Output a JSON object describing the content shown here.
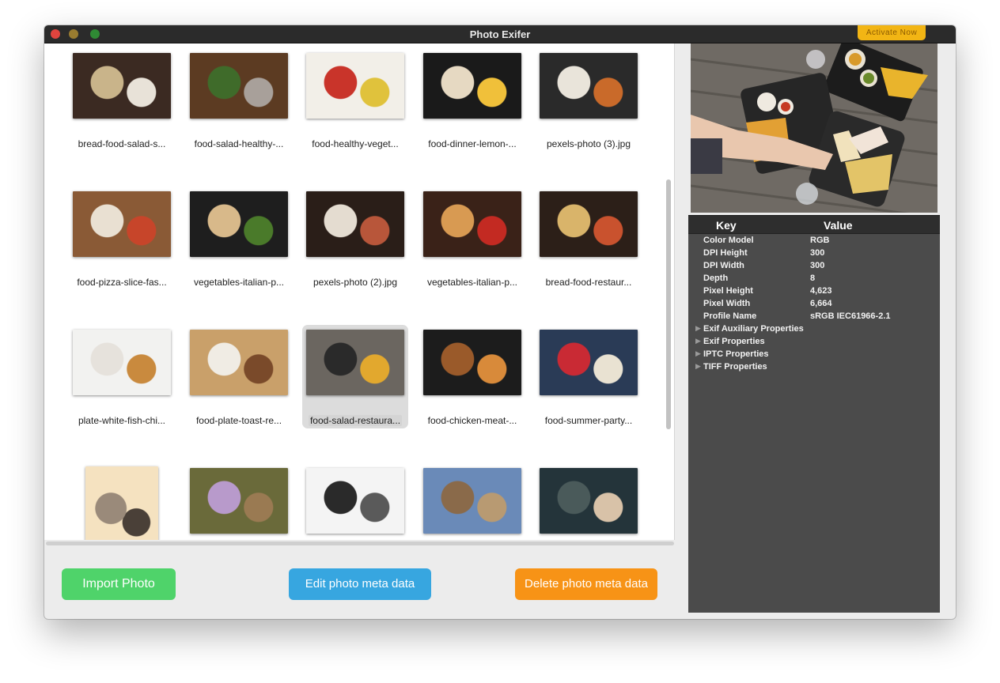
{
  "window": {
    "title": "Photo Exifer",
    "activate_label": "Activate Now"
  },
  "photos": [
    {
      "caption": "bread-food-salad-s...",
      "colors": [
        "#3b2a22",
        "#c9b48a",
        "#e8e2d8"
      ]
    },
    {
      "caption": "food-salad-healthy-...",
      "colors": [
        "#5c3b22",
        "#3f6b2a",
        "#a8a09a"
      ]
    },
    {
      "caption": "food-healthy-veget...",
      "colors": [
        "#f2efe8",
        "#c9342a",
        "#e0c23c"
      ]
    },
    {
      "caption": "food-dinner-lemon-...",
      "colors": [
        "#1a1a1a",
        "#e6d9c2",
        "#f0c03a"
      ]
    },
    {
      "caption": "pexels-photo (3).jpg",
      "colors": [
        "#2a2a2a",
        "#e9e4da",
        "#c96a2a"
      ]
    },
    {
      "caption": "food-pizza-slice-fas...",
      "colors": [
        "#8a5a36",
        "#e9e0d2",
        "#c7452a"
      ]
    },
    {
      "caption": "vegetables-italian-p...",
      "colors": [
        "#1e1e1e",
        "#d8b98a",
        "#4a7a2a"
      ]
    },
    {
      "caption": "pexels-photo (2).jpg",
      "colors": [
        "#2a1e18",
        "#e4dcd0",
        "#b8563a"
      ]
    },
    {
      "caption": "vegetables-italian-p...",
      "colors": [
        "#3a2218",
        "#d89a52",
        "#c32a22"
      ]
    },
    {
      "caption": "bread-food-restaur...",
      "colors": [
        "#2c1f18",
        "#d9b46a",
        "#c9522e"
      ]
    },
    {
      "caption": "plate-white-fish-chi...",
      "colors": [
        "#f2f2f0",
        "#e6e2dc",
        "#c98a3e"
      ]
    },
    {
      "caption": "food-plate-toast-re...",
      "colors": [
        "#c9a06a",
        "#f0ece4",
        "#7a4a2a"
      ]
    },
    {
      "caption": "food-salad-restaura...",
      "colors": [
        "#6b6660",
        "#2a2a2a",
        "#e2a82e"
      ]
    },
    {
      "caption": "food-chicken-meat-...",
      "colors": [
        "#1c1c1c",
        "#9a5a2a",
        "#d88a3a"
      ]
    },
    {
      "caption": "food-summer-party...",
      "colors": [
        "#2a3b56",
        "#c92a34",
        "#e9e2d2"
      ]
    },
    {
      "caption": "",
      "colors": [
        "#f5e2c0",
        "#9a8a7a",
        "#4a4038"
      ]
    },
    {
      "caption": "",
      "colors": [
        "#6a6a3a",
        "#b89acb",
        "#9a7a52"
      ]
    },
    {
      "caption": "",
      "colors": [
        "#f4f4f4",
        "#2a2a2a",
        "#5a5a5a"
      ]
    },
    {
      "caption": "",
      "colors": [
        "#6a8ab8",
        "#8a6a4a",
        "#b89a72"
      ]
    },
    {
      "caption": "",
      "colors": [
        "#24343a",
        "#4a5a5a",
        "#d8c2a8"
      ]
    }
  ],
  "selected_index": 12,
  "buttons": {
    "import": "Import Photo",
    "edit": "Edit photo meta data",
    "delete": "Delete photo meta data"
  },
  "meta": {
    "header_key": "Key",
    "header_value": "Value",
    "rows": [
      {
        "key": "Color Model",
        "value": "RGB"
      },
      {
        "key": "DPI Height",
        "value": "300"
      },
      {
        "key": "DPI Width",
        "value": "300"
      },
      {
        "key": "Depth",
        "value": "8"
      },
      {
        "key": "Pixel Height",
        "value": "4,623"
      },
      {
        "key": "Pixel Width",
        "value": "6,664"
      },
      {
        "key": "Profile Name",
        "value": "sRGB IEC61966-2.1"
      }
    ],
    "groups": [
      "Exif Auxiliary Properties",
      "Exif Properties",
      "IPTC Properties",
      "TIFF Properties"
    ]
  },
  "colors": {
    "import": "#4fd36a",
    "edit": "#37a6e0",
    "delete": "#f79316",
    "activate": "#f2b514",
    "panel": "#4b4b4b"
  }
}
